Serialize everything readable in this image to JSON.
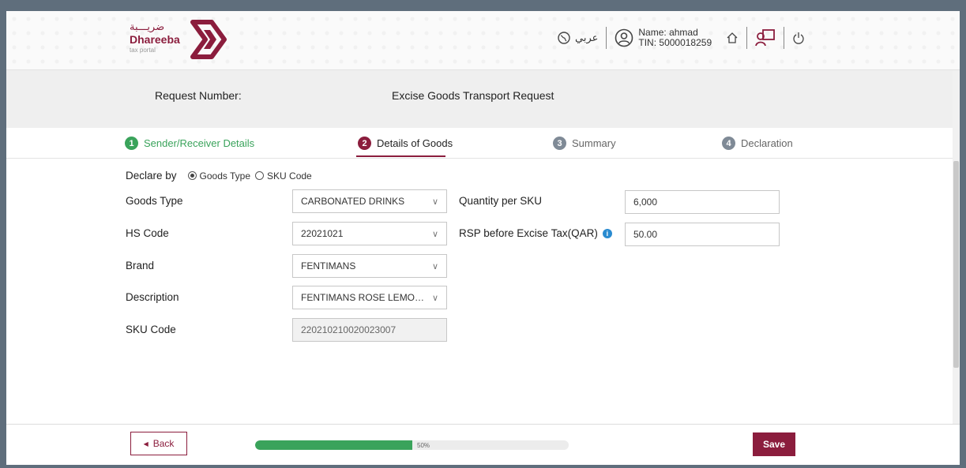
{
  "header": {
    "logo_arabic": "ضريـــبة",
    "logo_name": "Dhareeba",
    "logo_sub": "tax portal",
    "language_label": "عربي",
    "user_name": "Name: ahmad",
    "user_tin": "TIN: 5000018259",
    "icons": [
      "globe-icon",
      "user-icon",
      "home-icon",
      "request-icon",
      "power-icon"
    ]
  },
  "request": {
    "number_label": "Request Number:",
    "title": "Excise Goods Transport Request"
  },
  "steps": [
    {
      "num": "1",
      "label": "Sender/Receiver Details",
      "state": "done"
    },
    {
      "num": "2",
      "label": "Details of Goods",
      "state": "active"
    },
    {
      "num": "3",
      "label": "Summary",
      "state": "pending"
    },
    {
      "num": "4",
      "label": "Declaration",
      "state": "pending"
    }
  ],
  "form": {
    "declare_by_label": "Declare by",
    "declare_options": [
      "Goods Type",
      "SKU Code"
    ],
    "declare_selected": "Goods Type",
    "goods_type_label": "Goods Type",
    "goods_type_value": "CARBONATED DRINKS",
    "hs_code_label": "HS Code",
    "hs_code_value": "22021021",
    "brand_label": "Brand",
    "brand_value": "FENTIMANS",
    "description_label": "Description",
    "description_value": "FENTIMANS ROSE LEMONADE",
    "sku_code_label": "SKU Code",
    "sku_code_value": "220210210020023007",
    "qty_label": "Quantity per SKU",
    "qty_value": "6,000",
    "rsp_label": "RSP before Excise Tax(QAR)",
    "rsp_value": "50.00"
  },
  "footer": {
    "back_label": "Back",
    "save_label": "Save",
    "progress_text": "50%",
    "progress_fraction": 0.5
  },
  "colors": {
    "brand": "#8b1d3d",
    "success": "#3aa35b",
    "info": "#2a8bd0"
  }
}
